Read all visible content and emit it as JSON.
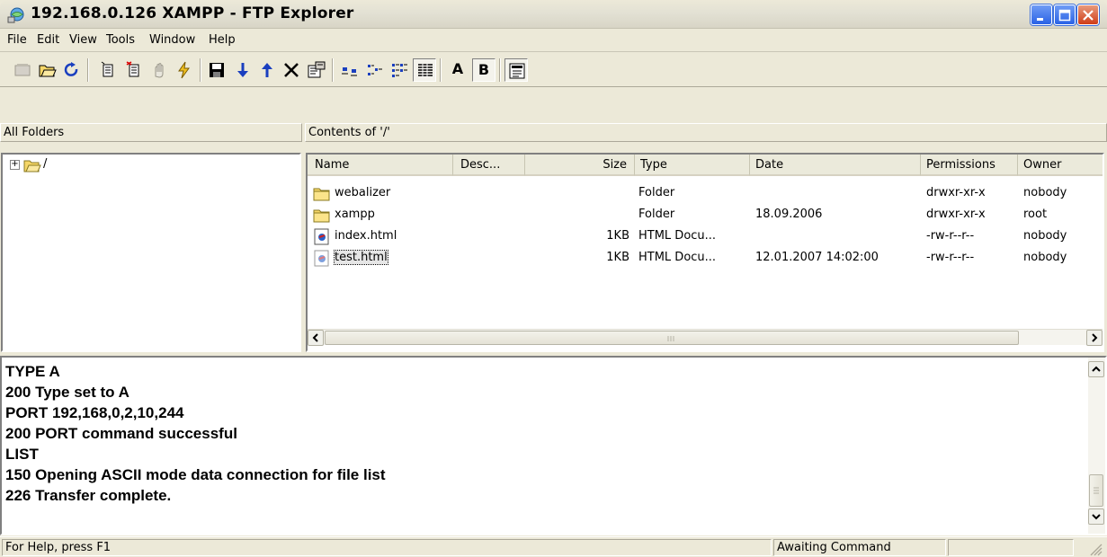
{
  "window": {
    "title": "192.168.0.126 XAMPP - FTP Explorer",
    "app_icon": "ftp-explorer-icon",
    "caption_buttons": [
      "minimize",
      "maximize",
      "close"
    ]
  },
  "menu": [
    "File",
    "Edit",
    "View",
    "Tools",
    "Window",
    "Help"
  ],
  "toolbar": {
    "buttons": [
      "connect-icon",
      "open-folder-icon",
      "refresh-icon",
      "new-folder-icon",
      "delete-folder-icon",
      "stop-icon",
      "quick-connect-icon",
      "save-icon",
      "download-icon",
      "upload-icon",
      "delete-icon",
      "properties-icon",
      "large-icons-view-icon",
      "small-icons-view-icon",
      "list-view-icon",
      "details-view-icon",
      "ascii-mode-button",
      "binary-mode-button",
      "log-view-icon"
    ],
    "ascii_label": "A",
    "binary_label": "B"
  },
  "folders_pane": {
    "header": "All Folders",
    "tree": [
      {
        "label": "/",
        "expander": "+"
      }
    ]
  },
  "contents_pane": {
    "header": "Contents of '/'",
    "columns": [
      "Name",
      "Desc...",
      "Size",
      "Type",
      "Date",
      "Permissions",
      "Owner"
    ],
    "rows": [
      {
        "icon": "folder-icon",
        "name": "webalizer",
        "desc": "",
        "size": "",
        "type": "Folder",
        "date": "",
        "permissions": "drwxr-xr-x",
        "owner": "nobody"
      },
      {
        "icon": "folder-icon",
        "name": "xampp",
        "desc": "",
        "size": "",
        "type": "Folder",
        "date": "18.09.2006",
        "permissions": "drwxr-xr-x",
        "owner": "root"
      },
      {
        "icon": "html-file-icon",
        "name": "index.html",
        "desc": "",
        "size": "1KB",
        "type": "HTML Docu...",
        "date": "",
        "permissions": "-rw-r--r--",
        "owner": "nobody"
      },
      {
        "icon": "html-file-icon",
        "name": "test.html",
        "desc": "",
        "size": "1KB",
        "type": "HTML Docu...",
        "date": "12.01.2007 14:02:00",
        "permissions": "-rw-r--r--",
        "owner": "nobody",
        "selected": true
      }
    ]
  },
  "log": {
    "lines": [
      "TYPE A",
      "200 Type set to A",
      "PORT 192,168,0,2,10,244",
      "200 PORT command successful",
      "LIST",
      "150 Opening ASCII mode data connection for file list",
      "226 Transfer complete."
    ]
  },
  "statusbar": {
    "help": "For Help, press F1",
    "state": "Awaiting Command",
    "extra": ""
  },
  "colors": {
    "titlebar": "#ece9d8",
    "window": "#ece9d8",
    "folder": "#f6d768",
    "caption_blue": "#2a62e5",
    "close_red": "#cf3d18"
  }
}
